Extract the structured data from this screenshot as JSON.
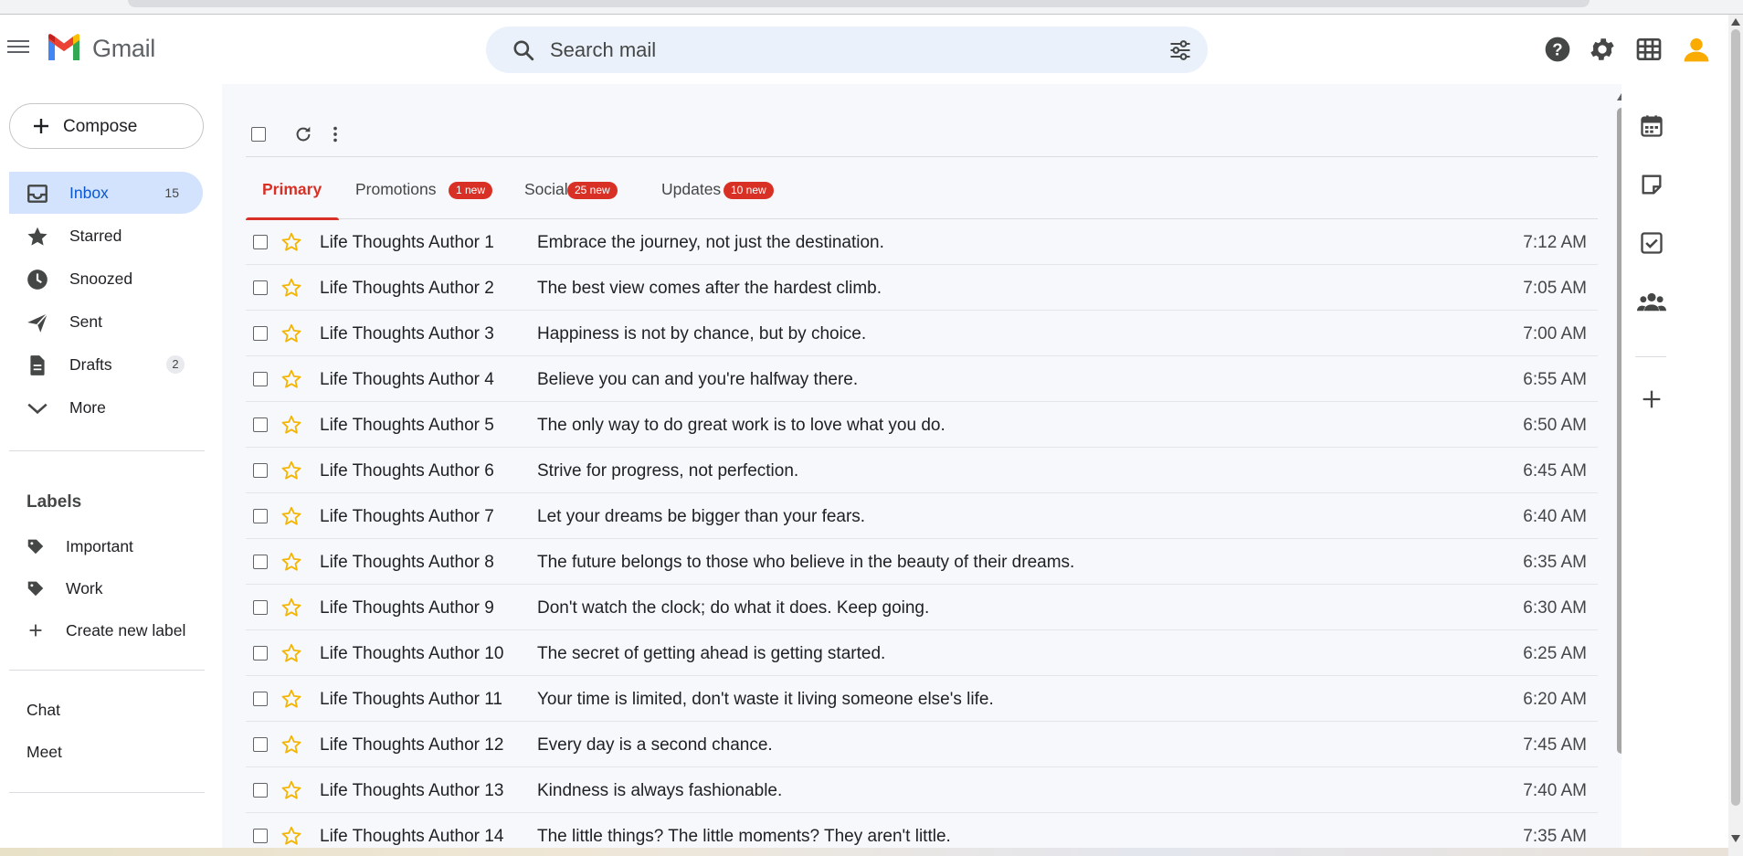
{
  "app": {
    "brand": "Gmail"
  },
  "search": {
    "placeholder": "Search mail"
  },
  "compose": {
    "label": "Compose"
  },
  "nav": [
    {
      "label": "Inbox",
      "count": "15",
      "icon": "inbox-icon",
      "active": true
    },
    {
      "label": "Starred",
      "icon": "star-icon"
    },
    {
      "label": "Snoozed",
      "icon": "clock-icon"
    },
    {
      "label": "Sent",
      "icon": "send-icon"
    },
    {
      "label": "Drafts",
      "count": "2",
      "icon": "draft-icon"
    },
    {
      "label": "More",
      "icon": "chevron-down-icon"
    }
  ],
  "labels": {
    "title": "Labels",
    "items": [
      {
        "label": "Important",
        "icon": "label-tag-icon"
      },
      {
        "label": "Work",
        "icon": "label-tag-icon"
      },
      {
        "label": "Create new label",
        "icon": "plus-icon"
      }
    ]
  },
  "links": {
    "chat": "Chat",
    "meet": "Meet"
  },
  "tabs": [
    {
      "label": "Primary",
      "active": true
    },
    {
      "label": "Promotions",
      "badge": "1 new"
    },
    {
      "label": "Social",
      "badge": "25 new"
    },
    {
      "label": "Updates",
      "badge": "10 new"
    }
  ],
  "emails": [
    {
      "sender": "Life Thoughts Author 1",
      "subject": "Embrace the journey, not just the destination.",
      "time": "7:12 AM"
    },
    {
      "sender": "Life Thoughts Author 2",
      "subject": "The best view comes after the hardest climb.",
      "time": "7:05 AM"
    },
    {
      "sender": "Life Thoughts Author 3",
      "subject": "Happiness is not by chance, but by choice.",
      "time": "7:00 AM"
    },
    {
      "sender": "Life Thoughts Author 4",
      "subject": "Believe you can and you're halfway there.",
      "time": "6:55 AM"
    },
    {
      "sender": "Life Thoughts Author 5",
      "subject": "The only way to do great work is to love what you do.",
      "time": "6:50 AM"
    },
    {
      "sender": "Life Thoughts Author 6",
      "subject": "Strive for progress, not perfection.",
      "time": "6:45 AM"
    },
    {
      "sender": "Life Thoughts Author 7",
      "subject": "Let your dreams be bigger than your fears.",
      "time": "6:40 AM"
    },
    {
      "sender": "Life Thoughts Author 8",
      "subject": "The future belongs to those who believe in the beauty of their dreams.",
      "time": "6:35 AM"
    },
    {
      "sender": "Life Thoughts Author 9",
      "subject": "Don't watch the clock; do what it does. Keep going.",
      "time": "6:30 AM"
    },
    {
      "sender": "Life Thoughts Author 10",
      "subject": "The secret of getting ahead is getting started.",
      "time": "6:25 AM"
    },
    {
      "sender": "Life Thoughts Author 11",
      "subject": "Your time is limited, don't waste it living someone else's life.",
      "time": "6:20 AM"
    },
    {
      "sender": "Life Thoughts Author 12",
      "subject": "Every day is a second chance.",
      "time": "7:45 AM"
    },
    {
      "sender": "Life Thoughts Author 13",
      "subject": "Kindness is always fashionable.",
      "time": "7:40 AM"
    },
    {
      "sender": "Life Thoughts Author 14",
      "subject": "The little things? The little moments? They aren't little.",
      "time": "7:35 AM"
    }
  ],
  "colors": {
    "accent_red": "#d93025",
    "active_nav_bg": "#d3e3fd",
    "active_nav_text": "#0b57d0",
    "star_outline": "#f4b400",
    "main_bg": "#f6f8fc",
    "avatar": "#f9ab00"
  },
  "right_panel_icons": [
    "calendar-icon",
    "keep-notes-icon",
    "tasks-icon",
    "contacts-icon",
    "add-addon-icon"
  ]
}
